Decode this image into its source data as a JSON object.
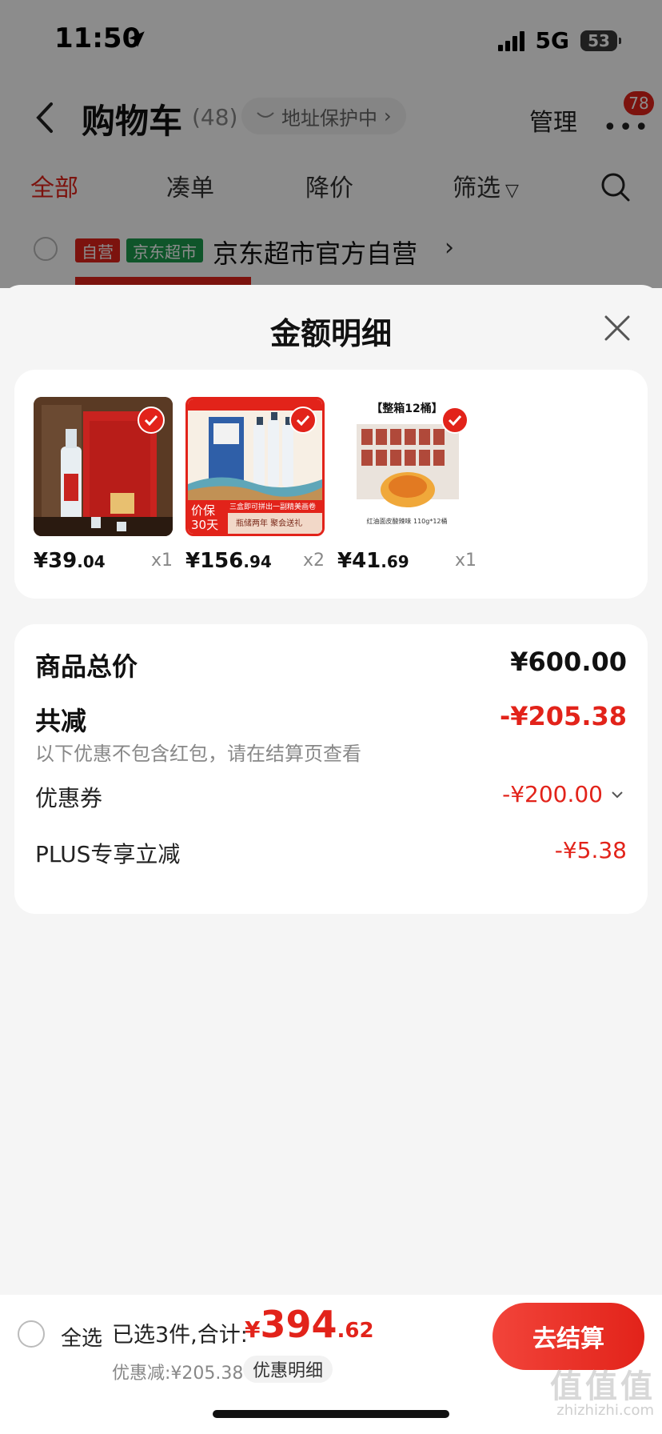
{
  "status_bar": {
    "time": "11:50",
    "network": "5G",
    "battery": "53"
  },
  "nav": {
    "title": "购物车",
    "count": "(48)",
    "address_pill": "地址保护中",
    "manage": "管理",
    "badge": "78"
  },
  "tabs": [
    "全部",
    "凑单",
    "降价",
    "筛选"
  ],
  "store": {
    "tag_self": "自营",
    "tag_market": "京东超市",
    "name": "京东超市官方自营"
  },
  "sheet": {
    "title": "金额明细",
    "products": [
      {
        "price_int": "¥39",
        "price_dec": ".04",
        "qty": "x1"
      },
      {
        "price_int": "¥156",
        "price_dec": ".94",
        "qty": "x2",
        "tag_top": "价保",
        "tag_bottom": "30天",
        "banner": "三盒即可拼出一副精美画卷",
        "banner2": "瓶储两年 聚会送礼"
      },
      {
        "price_int": "¥41",
        "price_dec": ".69",
        "qty": "x1",
        "header": "【整箱12桶】",
        "caption": "红油面皮酸辣味 110g*12桶"
      }
    ],
    "summary": {
      "total_label": "商品总价",
      "total_value": "¥600.00",
      "reduce_label": "共减",
      "reduce_value": "-¥205.38",
      "note": "以下优惠不包含红包，请在结算页查看",
      "coupon_label": "优惠券",
      "coupon_value": "-¥200.00",
      "plus_label": "PLUS专享立减",
      "plus_value": "-¥5.38"
    }
  },
  "bottom": {
    "select_all": "全选",
    "selected": "已选3件,合计:",
    "currency": "¥",
    "total_int": "394",
    "total_dec": ".62",
    "discount": "优惠减:¥205.38",
    "detail": "优惠明细",
    "checkout": "去结算"
  },
  "watermark": {
    "text": "值值值",
    "sub": "zhizhizhi.com"
  }
}
